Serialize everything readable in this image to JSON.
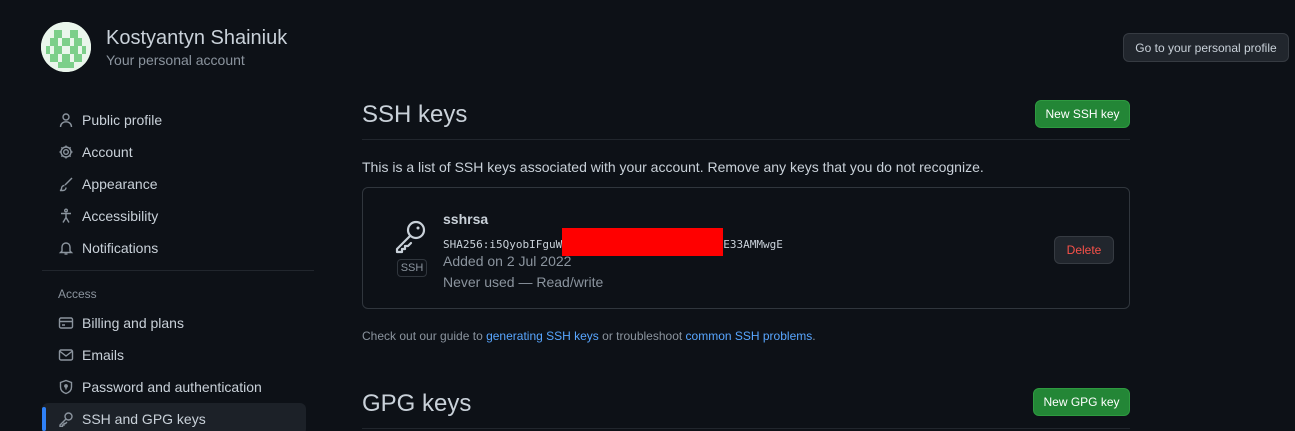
{
  "user": {
    "name": "Kostyantyn Shainiuk",
    "subtitle": "Your personal account",
    "profile_button": "Go to your personal profile"
  },
  "nav": {
    "items": [
      {
        "label": "Public profile",
        "icon": "person-icon"
      },
      {
        "label": "Account",
        "icon": "gear-icon"
      },
      {
        "label": "Appearance",
        "icon": "paintbrush-icon"
      },
      {
        "label": "Accessibility",
        "icon": "accessibility-icon"
      },
      {
        "label": "Notifications",
        "icon": "bell-icon"
      }
    ],
    "access_heading": "Access",
    "access_items": [
      {
        "label": "Billing and plans",
        "icon": "credit-card-icon"
      },
      {
        "label": "Emails",
        "icon": "mail-icon"
      },
      {
        "label": "Password and authentication",
        "icon": "shield-icon"
      },
      {
        "label": "SSH and GPG keys",
        "icon": "key-icon",
        "active": true
      }
    ]
  },
  "ssh": {
    "title": "SSH keys",
    "new_button": "New SSH key",
    "description": "This is a list of SSH keys associated with your account. Remove any keys that you do not recognize.",
    "key": {
      "badge": "SSH",
      "name": "sshrsa",
      "fingerprint_start": "SHA256:i5QyobIFguW",
      "fingerprint_end": "E33AMMwgE",
      "added": "Added on 2 Jul 2022",
      "usage": "Never used — Read/write",
      "delete_label": "Delete"
    },
    "guide": {
      "prefix": "Check out our guide to ",
      "link1": "generating SSH keys",
      "middle": " or troubleshoot ",
      "link2": "common SSH problems",
      "suffix": "."
    }
  },
  "gpg": {
    "title": "GPG keys",
    "new_button": "New GPG key"
  },
  "colors": {
    "background": "#0d1117",
    "accent_green": "#238636",
    "link_blue": "#58a6ff",
    "danger_red": "#f85149",
    "active_indicator": "#2f81f7"
  }
}
